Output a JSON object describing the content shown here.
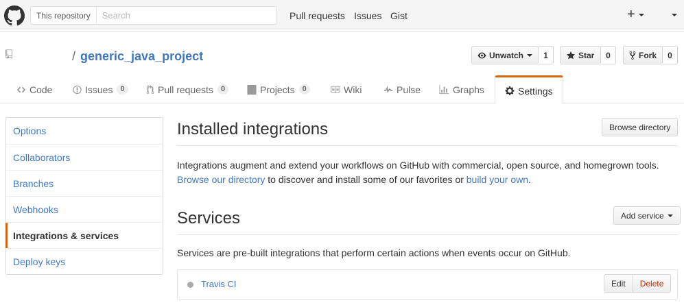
{
  "header": {
    "search_scope": "This repository",
    "search_placeholder": "Search",
    "nav": [
      "Pull requests",
      "Issues",
      "Gist"
    ],
    "plus": "+"
  },
  "repo": {
    "slash": "/",
    "name": "generic_java_project",
    "watch_label": "Unwatch",
    "watch_count": "1",
    "star_label": "Star",
    "star_count": "0",
    "fork_label": "Fork",
    "fork_count": "0"
  },
  "tabs": [
    {
      "label": "Code",
      "icon": "code-icon"
    },
    {
      "label": "Issues",
      "count": "0",
      "icon": "issue-icon"
    },
    {
      "label": "Pull requests",
      "count": "0",
      "icon": "pull-request-icon"
    },
    {
      "label": "Projects",
      "count": "0",
      "icon": "project-icon"
    },
    {
      "label": "Wiki",
      "icon": "book-icon"
    },
    {
      "label": "Pulse",
      "icon": "pulse-icon"
    },
    {
      "label": "Graphs",
      "icon": "graph-icon"
    },
    {
      "label": "Settings",
      "icon": "gear-icon",
      "selected": true
    }
  ],
  "sidebar": {
    "items": [
      {
        "label": "Options"
      },
      {
        "label": "Collaborators"
      },
      {
        "label": "Branches"
      },
      {
        "label": "Webhooks"
      },
      {
        "label": "Integrations & services",
        "selected": true
      },
      {
        "label": "Deploy keys"
      }
    ]
  },
  "integrations": {
    "title": "Installed integrations",
    "browse_button": "Browse directory",
    "desc_line1": "Integrations augment and extend your workflows on GitHub with commercial, open source, and homegrown tools.",
    "link_directory": "Browse our directory",
    "desc_mid": " to discover and install some of our favorites or ",
    "link_build": "build your own",
    "desc_end": "."
  },
  "services": {
    "title": "Services",
    "add_button": "Add service",
    "desc": "Services are pre-built integrations that perform certain actions when events occur on GitHub.",
    "items": [
      {
        "name": "Travis CI",
        "edit_label": "Edit",
        "delete_label": "Delete"
      }
    ]
  },
  "colors": {
    "link": "#4078c0",
    "accent": "#d26911",
    "danger": "#bd2c00"
  }
}
